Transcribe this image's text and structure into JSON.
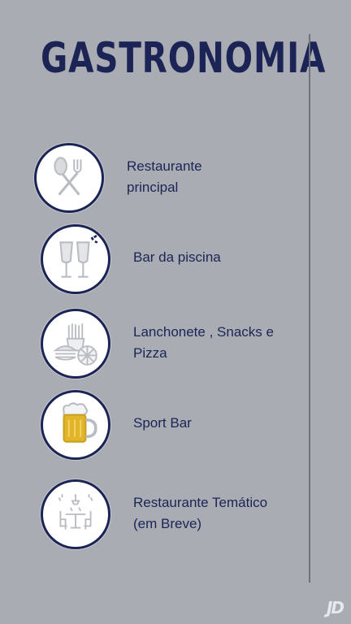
{
  "header": {
    "title": "GASTRONOMIA"
  },
  "items": [
    {
      "icon": "fork-spoon-icon",
      "label_line1": "Restaurante",
      "label_line2": "principal"
    },
    {
      "icon": "champagne-glasses-icon",
      "label_line1": "Bar da piscina",
      "label_line2": ""
    },
    {
      "icon": "fries-burger-pizza-icon",
      "label_line1": "Lanchonete , Snacks e",
      "label_line2": "Pizza"
    },
    {
      "icon": "beer-mug-icon",
      "label_line1": "Sport Bar",
      "label_line2": ""
    },
    {
      "icon": "restaurant-table-icon",
      "label_line1": "Restaurante Temático",
      "label_line2": "(em Breve)"
    }
  ],
  "watermark": {
    "text": "JD"
  },
  "colors": {
    "background": "#a9adb3",
    "primary": "#1c2455",
    "beer": "#e2b529"
  }
}
